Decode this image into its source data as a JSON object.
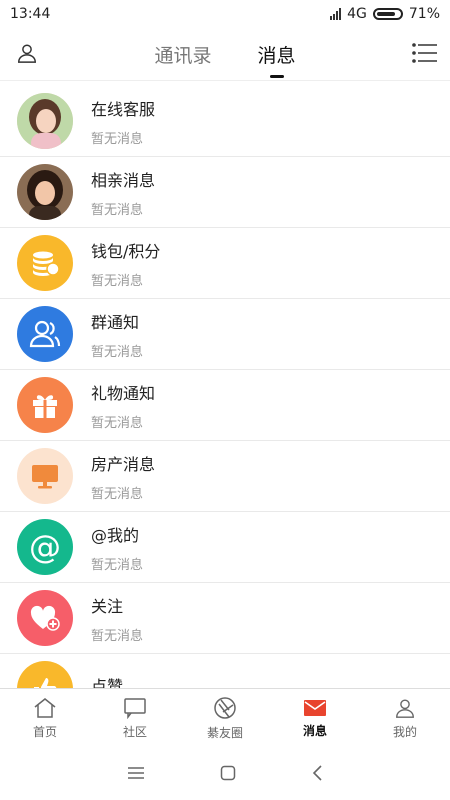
{
  "status": {
    "time": "13:44",
    "network": "4G",
    "battery": "71%"
  },
  "header": {
    "tabs": [
      {
        "label": "通讯录",
        "active": false
      },
      {
        "label": "消息",
        "active": true
      }
    ],
    "left_icon": "person-icon",
    "right_icon": "list-menu-icon"
  },
  "messages": [
    {
      "title": "在线客服",
      "subtitle": "暂无消息",
      "icon": "avatar-photo"
    },
    {
      "title": "相亲消息",
      "subtitle": "暂无消息",
      "icon": "avatar-photo"
    },
    {
      "title": "钱包/积分",
      "subtitle": "暂无消息",
      "icon": "coins-icon",
      "color": "#F9B82B"
    },
    {
      "title": "群通知",
      "subtitle": "暂无消息",
      "icon": "group-icon",
      "color": "#2F7BE0"
    },
    {
      "title": "礼物通知",
      "subtitle": "暂无消息",
      "icon": "gift-icon",
      "color": "#F6834A"
    },
    {
      "title": "房产消息",
      "subtitle": "暂无消息",
      "icon": "monitor-icon",
      "color": "#FCE3CF"
    },
    {
      "title": "@我的",
      "subtitle": "暂无消息",
      "icon": "at-icon",
      "color": "#14B88D"
    },
    {
      "title": "关注",
      "subtitle": "暂无消息",
      "icon": "heart-plus-icon",
      "color": "#F65E69"
    },
    {
      "title": "点赞",
      "subtitle": "",
      "icon": "thumb-icon",
      "color": "#F9B82B"
    }
  ],
  "bottom_nav": [
    {
      "label": "首页",
      "icon": "home-icon",
      "active": false
    },
    {
      "label": "社区",
      "icon": "chat-icon",
      "active": false
    },
    {
      "label": "綦友圈",
      "icon": "aperture-icon",
      "active": false
    },
    {
      "label": "消息",
      "icon": "mail-icon",
      "active": true,
      "color": "#E8442E"
    },
    {
      "label": "我的",
      "icon": "person-icon",
      "active": false
    }
  ]
}
